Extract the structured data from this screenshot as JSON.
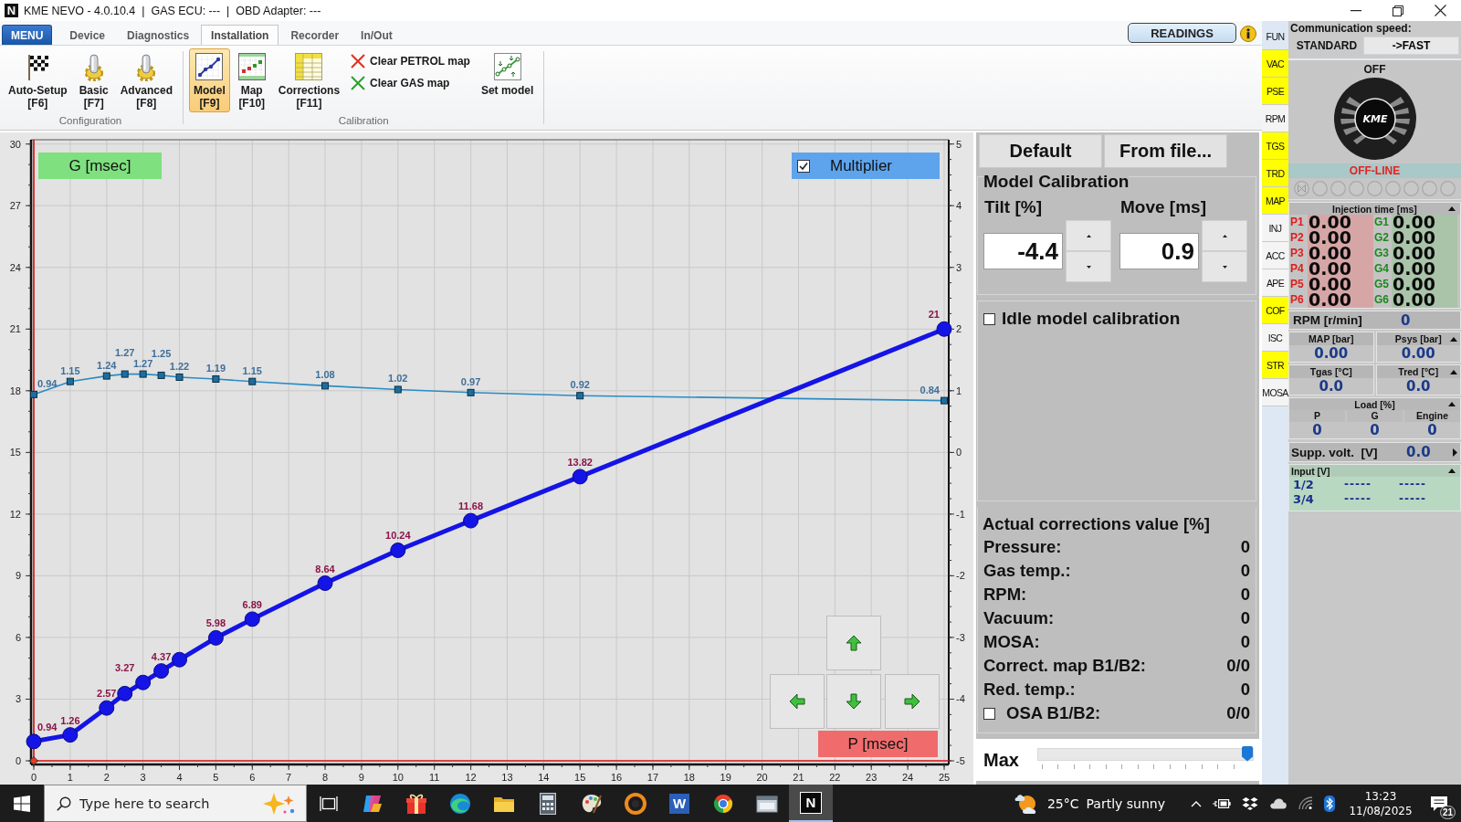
{
  "window": {
    "logo": "N",
    "title": "KME NEVO - 4.0.10.4  |  GAS ECU: ---  |  OBD Adapter: ---"
  },
  "ribbon": {
    "tabs": [
      {
        "label": "MENU",
        "kind": "menu",
        "selected": false
      },
      {
        "label": "Device",
        "kind": "tab",
        "selected": false
      },
      {
        "label": "Diagnostics",
        "kind": "tab",
        "selected": false
      },
      {
        "label": "Installation",
        "kind": "tab",
        "selected": true
      },
      {
        "label": "Recorder",
        "kind": "tab",
        "selected": false
      },
      {
        "label": "In/Out",
        "kind": "tab",
        "selected": false
      }
    ],
    "readings_button": "READINGS",
    "groups": [
      {
        "label": "Configuration",
        "items": [
          {
            "kind": "large",
            "label": "Auto-Setup",
            "shortcut": "[F6]",
            "selected": false
          },
          {
            "kind": "large",
            "label": "Basic",
            "shortcut": "[F7]",
            "selected": false
          },
          {
            "kind": "large",
            "label": "Advanced",
            "shortcut": "[F8]",
            "selected": false
          }
        ]
      },
      {
        "label": "Calibration",
        "items": [
          {
            "kind": "large",
            "label": "Model",
            "shortcut": "[F9]",
            "selected": true
          },
          {
            "kind": "large",
            "label": "Map",
            "shortcut": "[F10]",
            "selected": false
          },
          {
            "kind": "large",
            "label": "Corrections",
            "shortcut": "[F11]",
            "selected": false
          },
          {
            "kind": "small",
            "label": "Clear PETROL map",
            "color": "#e0301e",
            "selected": false
          },
          {
            "kind": "small",
            "label": "Clear GAS map",
            "color": "#2ca02c",
            "selected": false
          },
          {
            "kind": "large",
            "label": "Set model",
            "selected": false
          }
        ]
      }
    ]
  },
  "chart": {
    "chart_data": {
      "type": "line",
      "xlabel": "P [msec]",
      "ylabel": "G [msec]",
      "grid": true,
      "x": [
        0,
        1,
        2,
        2.5,
        3,
        3.5,
        4,
        5,
        6,
        8,
        10,
        12,
        15,
        25
      ],
      "series": [
        {
          "axis": "y2",
          "marker": "square",
          "color": "#2b8cc4",
          "values": [
            0.94,
            1.15,
            1.24,
            1.27,
            1.27,
            1.25,
            1.22,
            1.19,
            1.15,
            1.08,
            1.02,
            0.97,
            0.92,
            0.84
          ],
          "value_labels": [
            "0.94",
            "1.15",
            "1.24",
            "1.27",
            "1.27",
            "1.25",
            "1.22",
            "1.19",
            "1.15",
            "1.08",
            "1.02",
            "0.97",
            "0.92",
            "0.84"
          ]
        },
        {
          "marker": "circle",
          "color": "#1414e6",
          "values": [
            0.94,
            1.26,
            2.57,
            3.27,
            3.81,
            4.37,
            4.92,
            5.98,
            6.89,
            8.64,
            10.24,
            11.68,
            13.82,
            21
          ],
          "value_labels": [
            "0.94",
            "1.26",
            "2.57",
            "3.27",
            null,
            "4.37",
            null,
            "5.98",
            "6.89",
            "8.64",
            "10.24",
            "11.68",
            "13.82",
            "21"
          ]
        }
      ],
      "xlim": [
        0,
        25
      ],
      "ylim": [
        0,
        30
      ],
      "y2lim": [
        -5,
        5
      ],
      "xticks": [
        0,
        1,
        2,
        3,
        4,
        5,
        6,
        7,
        8,
        9,
        10,
        11,
        12,
        13,
        14,
        15,
        16,
        17,
        18,
        19,
        20,
        21,
        22,
        23,
        24,
        25
      ],
      "yticks": [
        0,
        3,
        6,
        9,
        12,
        15,
        18,
        21,
        24,
        27,
        30
      ],
      "y2ticks": [
        -5,
        -4,
        -3,
        -2,
        -1,
        0,
        1,
        2,
        3,
        4,
        5
      ]
    },
    "multiplier": {
      "label": "Multiplier",
      "checked": true
    }
  },
  "model_panel": {
    "buttons": [
      "Default",
      "From file..."
    ],
    "title": "Model Calibration",
    "fields": [
      {
        "label": "Tilt [%]",
        "value": "-4.4"
      },
      {
        "label": "Move [ms]",
        "value": "0.9"
      }
    ],
    "idle_calibration": {
      "label": "Idle model calibration",
      "checked": false
    },
    "corrections": {
      "title": "Actual corrections value [%]",
      "rows": [
        {
          "kind": "text",
          "label": "Pressure:",
          "value": "0"
        },
        {
          "kind": "text",
          "label": "Gas temp.:",
          "value": "0"
        },
        {
          "kind": "text",
          "label": "RPM:",
          "value": "0"
        },
        {
          "kind": "text",
          "label": "Vacuum:",
          "value": "0"
        },
        {
          "kind": "text",
          "label": "MOSA:",
          "value": "0"
        },
        {
          "kind": "text",
          "label": "Correct. map B1/B2:",
          "value": "0/0"
        },
        {
          "kind": "text",
          "label": "Red. temp.:",
          "value": "0"
        },
        {
          "kind": "checkbox",
          "label": "OSA B1/B2:",
          "value": "0/0",
          "checked": false
        }
      ]
    },
    "range": {
      "label": "Max",
      "level": 1.0
    }
  },
  "side_tabs": [
    {
      "label": "FUN",
      "selected": true,
      "highlighted": false
    },
    {
      "label": "VAC",
      "selected": false,
      "highlighted": true
    },
    {
      "label": "PSE",
      "selected": false,
      "highlighted": true
    },
    {
      "label": "RPM",
      "selected": false,
      "highlighted": false
    },
    {
      "label": "TGS",
      "selected": false,
      "highlighted": true
    },
    {
      "label": "TRD",
      "selected": false,
      "highlighted": true
    },
    {
      "label": "MAP",
      "selected": false,
      "highlighted": true
    },
    {
      "label": "INJ",
      "selected": false,
      "highlighted": false
    },
    {
      "label": "ACC",
      "selected": false,
      "highlighted": false
    },
    {
      "label": "APE",
      "selected": false,
      "highlighted": false
    },
    {
      "label": "COF",
      "selected": false,
      "highlighted": true
    },
    {
      "label": "ISC",
      "selected": false,
      "highlighted": false
    },
    {
      "label": "STR",
      "selected": false,
      "highlighted": true
    },
    {
      "label": "MOSA",
      "selected": false,
      "highlighted": false
    }
  ],
  "status": {
    "comm_title": "Communication speed:",
    "speed_label": "STANDARD",
    "speed_button": "->FAST",
    "state": "OFF",
    "logo_text": "KME",
    "connection": "OFF-LINE",
    "indicators": [
      {
        "kind": "valve",
        "on": false
      },
      {
        "kind": "led",
        "on": false
      },
      {
        "kind": "led",
        "on": false
      },
      {
        "kind": "led",
        "on": false
      },
      {
        "kind": "led",
        "on": false
      },
      {
        "kind": "led",
        "on": false
      },
      {
        "kind": "led",
        "on": false
      },
      {
        "kind": "led",
        "on": false
      },
      {
        "kind": "led",
        "on": false
      }
    ],
    "injection": {
      "title": "Injection time [ms]",
      "expanded": true,
      "petrol": [
        {
          "label": "P1",
          "value": "0.00"
        },
        {
          "label": "P2",
          "value": "0.00"
        },
        {
          "label": "P3",
          "value": "0.00"
        },
        {
          "label": "P4",
          "value": "0.00"
        },
        {
          "label": "P5",
          "value": "0.00"
        },
        {
          "label": "P6",
          "value": "0.00"
        }
      ],
      "gas": [
        {
          "label": "G1",
          "value": "0.00"
        },
        {
          "label": "G2",
          "value": "0.00"
        },
        {
          "label": "G3",
          "value": "0.00"
        },
        {
          "label": "G4",
          "value": "0.00"
        },
        {
          "label": "G5",
          "value": "0.00"
        },
        {
          "label": "G6",
          "value": "0.00"
        }
      ]
    },
    "rpm": {
      "label": "RPM [r/min]",
      "value": "0"
    },
    "pressures": {
      "expanded": true,
      "cells": [
        {
          "label": "MAP [bar]",
          "value": "0.00"
        },
        {
          "label": "Psys [bar]",
          "value": "0.00"
        }
      ]
    },
    "temperatures": {
      "expanded": true,
      "cells": [
        {
          "label": "Tgas [°C]",
          "value": "0.0"
        },
        {
          "label": "Tred [°C]",
          "value": "0.0"
        }
      ]
    },
    "load": {
      "title": "Load [%]",
      "expanded": true,
      "cells": [
        {
          "label": "P",
          "value": "0"
        },
        {
          "label": "G",
          "value": "0"
        },
        {
          "label": "Engine",
          "value": "0"
        }
      ]
    },
    "supply": {
      "label": "Supp. volt.  [V]",
      "value": "0.0",
      "expanded": false
    },
    "inputs": {
      "title": "Input [V]",
      "expanded": true,
      "rows": [
        {
          "label": "1/2",
          "values": [
            "-----",
            "-----"
          ]
        },
        {
          "label": "3/4",
          "values": [
            "-----",
            "-----"
          ]
        }
      ]
    }
  },
  "taskbar": {
    "search_placeholder": "Type here to search",
    "apps": [
      {
        "active": false
      },
      {
        "active": false
      },
      {
        "active": false
      },
      {
        "active": false
      },
      {
        "active": false
      },
      {
        "active": false
      },
      {
        "active": false
      },
      {
        "letter": "W",
        "active": false
      },
      {
        "active": false
      },
      {
        "active": false
      },
      {
        "letter": "N",
        "active": true
      }
    ],
    "weather": {
      "temperature": "25°C",
      "condition": "Partly sunny"
    },
    "time": "13:23",
    "date": "11/08/2025",
    "notifications": "21"
  }
}
